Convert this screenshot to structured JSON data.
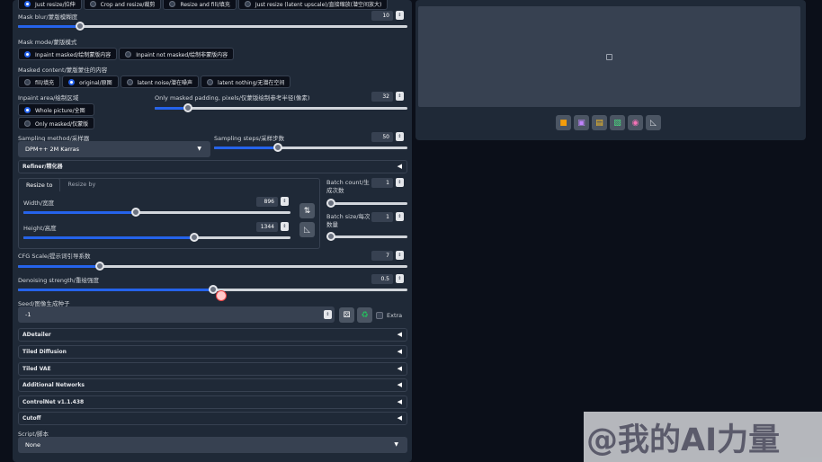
{
  "resize_mode": {
    "options": [
      "Just resize/拉伸",
      "Crop and resize/裁剪",
      "Resize and fill/填充",
      "Just resize (latent upscale)/直接缩放(潜空间放大)"
    ],
    "selected": 0
  },
  "mask_blur": {
    "label": "Mask blur/蒙版模糊度",
    "value": "10",
    "fraction": 0.16
  },
  "mask_mode": {
    "label": "Mask mode/蒙版模式",
    "options": [
      "Inpaint masked/绘制蒙版内容",
      "Inpaint not masked/绘制非蒙版内容"
    ],
    "selected": 0
  },
  "masked_content": {
    "label": "Masked content/蒙版蒙住的内容",
    "options": [
      "fill/填充",
      "original/原图",
      "latent noise/潜在噪声",
      "latent nothing/无潜在空间"
    ],
    "selected": 1
  },
  "inpaint_area": {
    "label": "Inpaint area/绘制区域",
    "options": [
      "Whole picture/全图",
      "Only masked/仅蒙版"
    ],
    "selected": 0
  },
  "only_masked_padding": {
    "label": "Only masked padding, pixels/仅蒙版绘制参考半径(像素)",
    "value": "32",
    "fraction": 0.13
  },
  "sampling_method": {
    "label": "Sampling method/采样器",
    "value": "DPM++ 2M Karras"
  },
  "sampling_steps": {
    "label": "Sampling steps/采样步数",
    "value": "50",
    "fraction": 0.33
  },
  "refiner": {
    "label": "Refiner/精化器"
  },
  "size_tabs": [
    "Resize to",
    "Resize by"
  ],
  "width": {
    "label": "Width/宽度",
    "value": "896",
    "fraction": 0.42
  },
  "height": {
    "label": "Height/高度",
    "value": "1344",
    "fraction": 0.64
  },
  "batch_count": {
    "label": "Batch count/生成次数",
    "value": "1",
    "fraction": 0.0
  },
  "batch_size": {
    "label": "Batch size/每次数量",
    "value": "1",
    "fraction": 0.0
  },
  "cfg_scale": {
    "label": "CFG Scale/提示词引导系数",
    "value": "7",
    "fraction": 0.21
  },
  "denoising": {
    "label": "Denoising strength/重绘强度",
    "value": "0.5",
    "fraction": 0.5
  },
  "seed": {
    "label": "Seed/图像生成种子",
    "value": "-1",
    "extra_label": "Extra"
  },
  "sections": [
    "ADetailer",
    "Tiled Diffusion",
    "Tiled VAE",
    "Additional Networks",
    "ControlNet v1.1.438",
    "Cutoff"
  ],
  "script": {
    "label": "Script/脚本",
    "value": "None"
  },
  "output_icons": [
    "folder-icon",
    "save-icon",
    "zip-icon",
    "send-to-img2img-icon",
    "send-to-inpaint-icon",
    "send-to-extras-icon"
  ],
  "watermark": {
    "text": "@我的AI力量"
  },
  "colors": {
    "accent": "#2563eb",
    "panel": "#1f2937",
    "background": "#0b0f19"
  }
}
